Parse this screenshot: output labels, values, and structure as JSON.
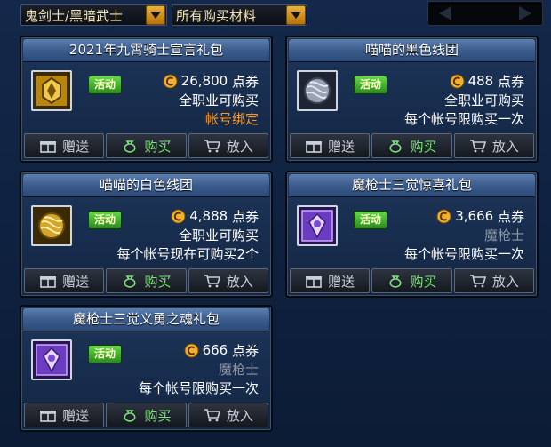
{
  "filters": {
    "character": "鬼剑士/黑暗武士",
    "category": "所有购买材料"
  },
  "colors": {
    "accent_gold": "#e9b23b",
    "tag_green": "#43b52f",
    "restricted_orange": "#ff9a1f",
    "muted_gray": "#8d97a6"
  },
  "buttons": {
    "gift": "赠送",
    "buy": "购买",
    "cart": "放入"
  },
  "items": [
    {
      "name": "2021年九霄骑士宣言礼包",
      "tag": "活动",
      "price": "26,800",
      "unit": "点券",
      "line2": "全职业可购买",
      "line3": "帐号绑定",
      "icon": "gold-crest-box"
    },
    {
      "name": "喵喵的黑色线团",
      "tag": "活动",
      "price": "488",
      "unit": "点券",
      "line2": "全职业可购买",
      "line3": "每个帐号限购买一次",
      "icon": "dark-yarn-ball"
    },
    {
      "name": "喵喵的白色线团",
      "tag": "活动",
      "price": "4,888",
      "unit": "点券",
      "line2": "全职业可购买",
      "line3": "每个帐号现在可购买2个",
      "icon": "golden-yarn-ball"
    },
    {
      "name": "魔枪士三觉惊喜礼包",
      "tag": "活动",
      "price": "3,666",
      "unit": "点券",
      "line2": "魔枪士",
      "line3": "每个帐号限购买一次",
      "icon": "purple-lancer-box"
    },
    {
      "name": "魔枪士三觉义勇之魂礼包",
      "tag": "活动",
      "price": "666",
      "unit": "点券",
      "line2": "魔枪士",
      "line3": "每个帐号限购买一次",
      "icon": "purple-lancer-box"
    }
  ]
}
